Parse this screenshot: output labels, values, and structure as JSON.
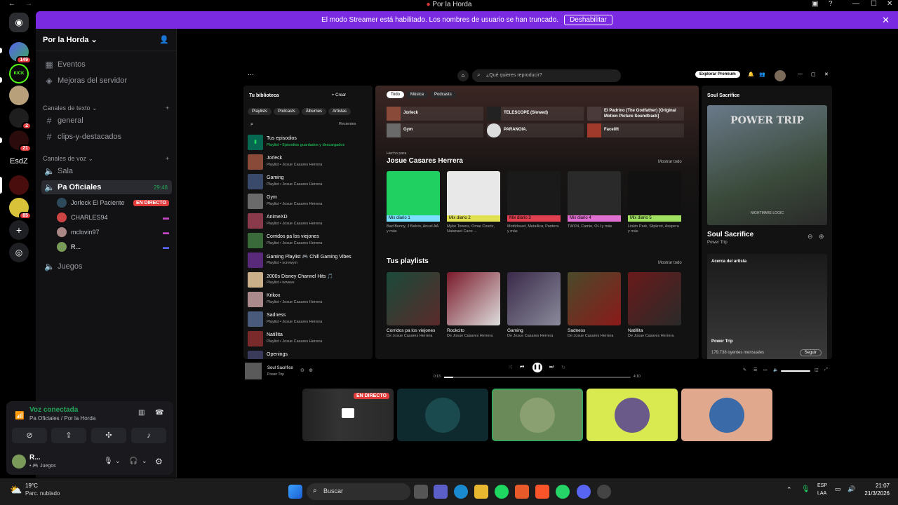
{
  "window": {
    "title": "Por la Horda"
  },
  "banner": {
    "text": "El modo Streamer está habilitado. Los nombres de usuario se han truncado.",
    "button": "Deshabilitar"
  },
  "servers": {
    "badge1": "149",
    "badge2": "2",
    "badge3": "21",
    "label": "EsdZ",
    "badge4": "85"
  },
  "sidebar": {
    "server_name": "Por la Horda",
    "events": "Eventos",
    "boosts": "Mejoras del servidor",
    "text_category": "Canales de texto",
    "text_channels": [
      "general",
      "clips-y-destacados"
    ],
    "voice_category": "Canales de voz",
    "voice_channels": [
      "Sala",
      "Pa Oficiales",
      "Juegos"
    ],
    "voice_timer": "29:48",
    "users": [
      "Jorleck El Paciente",
      "CHARLES94",
      "mclovin97",
      "R..."
    ],
    "live_badge": "EN DIRECTO"
  },
  "voice_panel": {
    "status": "Voz conectada",
    "location": "Pa Oficiales / Por la Horda",
    "user": "R...",
    "activity": "Juegos"
  },
  "spotify": {
    "search_placeholder": "¿Qué quieres reproducir?",
    "premium": "Explorar Premium",
    "library_title": "Tu biblioteca",
    "create": "+ Crear",
    "library_filters": [
      "Playlists",
      "Podcasts",
      "Álbumes",
      "Artistas"
    ],
    "recent": "Recientes",
    "library": [
      {
        "name": "Tus episodios",
        "sub": "Playlist • Episodios guardados y descargados"
      },
      {
        "name": "Jorleck",
        "sub": "Playlist • Josue Casares Herrera"
      },
      {
        "name": "Gaming",
        "sub": "Playlist • Josue Casares Herrera"
      },
      {
        "name": "Gym",
        "sub": "Playlist • Josue Casares Herrera"
      },
      {
        "name": "AnimeXD",
        "sub": "Playlist • Josue Casares Herrera"
      },
      {
        "name": "Corridos pa los viejones",
        "sub": "Playlist • Josue Casares Herrera"
      },
      {
        "name": "Gaming Playlist 🎮 Chill Gaming Vibes",
        "sub": "Playlist • screwym"
      },
      {
        "name": "2000s Disney Channel Hits 🎵",
        "sub": "Playlist • tvwave"
      },
      {
        "name": "Krikox",
        "sub": "Playlist • Josue Casares Herrera"
      },
      {
        "name": "Sadness",
        "sub": "Playlist • Josue Casares Herrera"
      },
      {
        "name": "Natillita",
        "sub": "Playlist • Josue Casares Herrera"
      },
      {
        "name": "Openings",
        "sub": ""
      }
    ],
    "tabs": [
      "Todo",
      "Música",
      "Podcasts"
    ],
    "quick": [
      "Jorleck",
      "TELESCOPE (Slowed)",
      "El Padrino (The Godfather) [Original Motion Picture Soundtrack]",
      "Gym",
      "PARANOIA.",
      "Facelift"
    ],
    "made_for": "Hecho para",
    "user_name": "Josue Casares Herrera",
    "show_all": "Mostrar todo",
    "mixes": [
      {
        "label": "Mix diario 1",
        "desc": "Bad Bunny, J Balvin, Anuel AA y más"
      },
      {
        "label": "Mix diario 2",
        "desc": "Myke Towers, Omar Courtz, Natanael Cano ..."
      },
      {
        "label": "Mix diario 3",
        "desc": "Motörhead, Metallica, Pantera y más"
      },
      {
        "label": "Mix diario 4",
        "desc": "TWXN, Camie, OLI y más"
      },
      {
        "label": "Mix diario 5",
        "desc": "Linkin Park, Slipknot, Asspera y más"
      }
    ],
    "playlists_title": "Tus playlists",
    "playlists": [
      {
        "name": "Corridos pa los viejones",
        "by": "De Josue Casares Herrera"
      },
      {
        "name": "Rockcito",
        "by": "De Josue Casares Herrera"
      },
      {
        "name": "Gaming",
        "by": "De Josue Casares Herrera"
      },
      {
        "name": "Sadness",
        "by": "De Josue Casares Herrera"
      },
      {
        "name": "Natillita",
        "by": "De Josue Casares Herrera"
      }
    ],
    "now_playing_panel": "Soul Sacrifice",
    "album_text": "POWER TRIP",
    "album_sub": "NIGHTMARE LOGIC",
    "track": "Soul Sacrifice",
    "artist": "Power Trip",
    "about_artist": "Acerca del artista",
    "listeners": "179.738 oyentes mensuales",
    "follow": "Seguir",
    "time_current": "0:13",
    "time_total": "4:10"
  },
  "stream_tile": {
    "badge": "EN DIRECTO"
  },
  "taskbar": {
    "temp": "19°C",
    "weather": "Parc. nublado",
    "search": "Buscar",
    "lang": "ESP",
    "region": "LAA",
    "time": "21:07",
    "date": "21/3/2026"
  },
  "colors": {
    "brand": "#7a2be2",
    "spotify_green": "#1ed760",
    "live": "#e03c3c"
  }
}
